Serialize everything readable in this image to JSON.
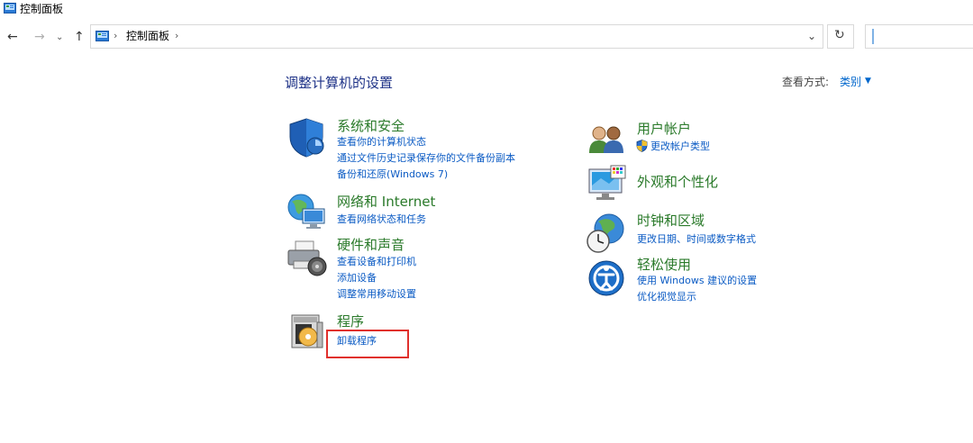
{
  "window": {
    "title": "控制面板"
  },
  "nav": {
    "back": "←",
    "forward": "→",
    "recent": "⌄",
    "up": "↑",
    "breadcrumb": "控制面板",
    "sep": "›",
    "dropdown": "⌄",
    "refresh": "↻"
  },
  "header": {
    "title": "调整计算机的设置",
    "view_by_label": "查看方式:",
    "view_by_value": "类别",
    "view_by_arrow": "▼"
  },
  "categories": {
    "system": {
      "title": "系统和安全",
      "links": [
        "查看你的计算机状态",
        "通过文件历史记录保存你的文件备份副本",
        "备份和还原(Windows 7)"
      ]
    },
    "network": {
      "title": "网络和 Internet",
      "links": [
        "查看网络状态和任务"
      ]
    },
    "hardware": {
      "title": "硬件和声音",
      "links": [
        "查看设备和打印机",
        "添加设备",
        "调整常用移动设置"
      ]
    },
    "programs": {
      "title": "程序",
      "links": [
        "卸载程序"
      ]
    },
    "accounts": {
      "title": "用户帐户",
      "links": [
        "更改帐户类型"
      ]
    },
    "appearance": {
      "title": "外观和个性化",
      "links": []
    },
    "clock": {
      "title": "时钟和区域",
      "links": [
        "更改日期、时间或数字格式"
      ]
    },
    "ease": {
      "title": "轻松使用",
      "links": [
        "使用 Windows 建议的设置",
        "优化视觉显示"
      ]
    }
  },
  "colors": {
    "category_title": "#2a7a2a",
    "link": "#0b5bc4",
    "heading": "#1e3287",
    "highlight": "#e0302c"
  },
  "icons": [
    "control-panel-icon",
    "shield-icon",
    "network-icon",
    "printer-icon",
    "programs-icon",
    "users-icon",
    "uac-shield-icon",
    "appearance-icon",
    "clock-globe-icon",
    "ease-of-access-icon"
  ]
}
